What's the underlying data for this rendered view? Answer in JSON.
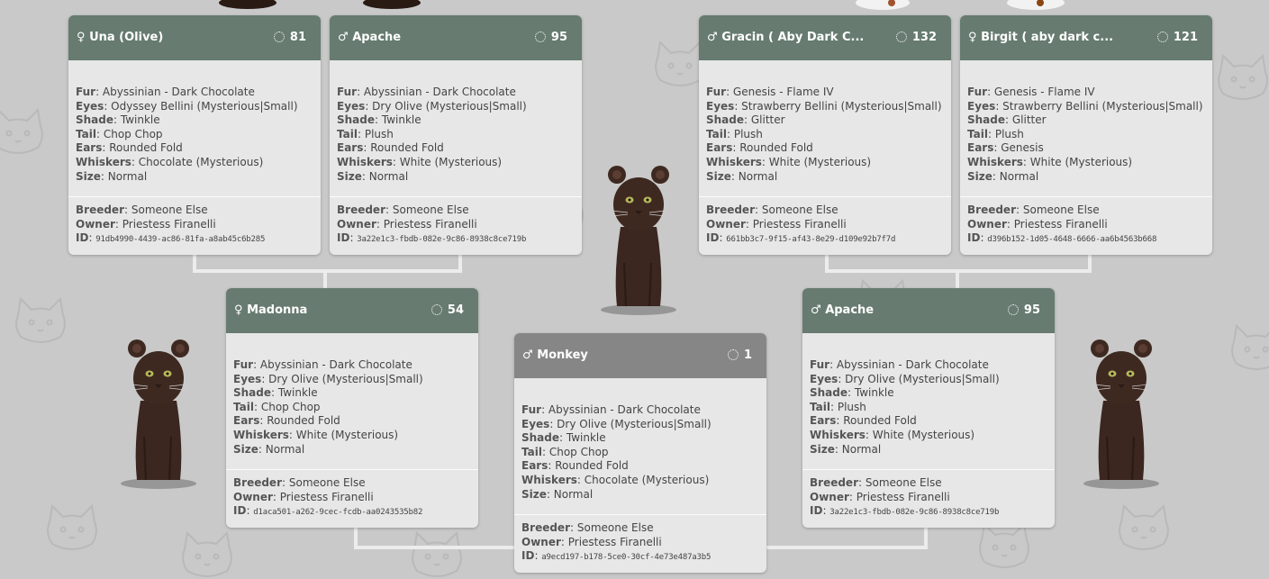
{
  "label_keys": {
    "fur": "Fur",
    "eyes": "Eyes",
    "shade": "Shade",
    "tail": "Tail",
    "ears": "Ears",
    "whiskers": "Whiskers",
    "size": "Size",
    "breeder": "Breeder",
    "owner": "Owner",
    "id": "ID"
  },
  "colors": {
    "header": "#677b70",
    "child_header": "#868686",
    "card_body": "#e7e7e7",
    "background": "#c9c9c9",
    "connector": "#ececec"
  },
  "cats": {
    "una": {
      "sex_symbol": "♀",
      "name": "Una (Olive)",
      "generation": "81",
      "fur": "Abyssinian - Dark Chocolate",
      "eyes": "Odyssey Bellini (Mysterious|Small)",
      "shade": "Twinkle",
      "tail": "Chop Chop",
      "ears": "Rounded Fold",
      "whiskers": "Chocolate (Mysterious)",
      "size": "Normal",
      "breeder": "Someone Else",
      "owner": "Priestess Firanelli",
      "id": "91db4990-4439-ac86-81fa-a8ab45c6b285"
    },
    "apache_top": {
      "sex_symbol": "♂",
      "name": "Apache",
      "generation": "95",
      "fur": "Abyssinian - Dark Chocolate",
      "eyes": "Dry Olive (Mysterious|Small)",
      "shade": "Twinkle",
      "tail": "Plush",
      "ears": "Rounded Fold",
      "whiskers": "White (Mysterious)",
      "size": "Normal",
      "breeder": "Someone Else",
      "owner": "Priestess Firanelli",
      "id": "3a22e1c3-fbdb-082e-9c86-8938c8ce719b"
    },
    "gracin": {
      "sex_symbol": "♂",
      "name": "Gracin ( Aby Dark C...",
      "generation": "132",
      "fur": "Genesis - Flame IV",
      "eyes": "Strawberry Bellini (Mysterious|Small)",
      "shade": "Glitter",
      "tail": "Plush",
      "ears": "Rounded Fold",
      "whiskers": "White (Mysterious)",
      "size": "Normal",
      "breeder": "Someone Else",
      "owner": "Priestess Firanelli",
      "id": "661bb3c7-9f15-af43-8e29-d109e92b7f7d"
    },
    "birgit": {
      "sex_symbol": "♀",
      "name": "Birgit ( aby dark c...",
      "generation": "121",
      "fur": "Genesis - Flame IV",
      "eyes": "Strawberry Bellini (Mysterious|Small)",
      "shade": "Glitter",
      "tail": "Plush",
      "ears": "Genesis",
      "whiskers": "White (Mysterious)",
      "size": "Normal",
      "breeder": "Someone Else",
      "owner": "Priestess Firanelli",
      "id": "d396b152-1d05-4648-6666-aa6b4563b668"
    },
    "madonna": {
      "sex_symbol": "♀",
      "name": "Madonna",
      "generation": "54",
      "fur": "Abyssinian - Dark Chocolate",
      "eyes": "Dry Olive (Mysterious|Small)",
      "shade": "Twinkle",
      "tail": "Chop Chop",
      "ears": "Rounded Fold",
      "whiskers": "White (Mysterious)",
      "size": "Normal",
      "breeder": "Someone Else",
      "owner": "Priestess Firanelli",
      "id": "d1aca501-a262-9cec-fcdb-aa0243535b82"
    },
    "monkey": {
      "sex_symbol": "♂",
      "name": "Monkey",
      "generation": "1",
      "fur": "Abyssinian - Dark Chocolate",
      "eyes": "Dry Olive (Mysterious|Small)",
      "shade": "Twinkle",
      "tail": "Chop Chop",
      "ears": "Rounded Fold",
      "whiskers": "Chocolate (Mysterious)",
      "size": "Normal",
      "breeder": "Someone Else",
      "owner": "Priestess Firanelli",
      "id": "a9ecd197-b178-5ce0-30cf-4e73e487a3b5"
    },
    "apache_mid": {
      "sex_symbol": "♂",
      "name": "Apache",
      "generation": "95",
      "fur": "Abyssinian - Dark Chocolate",
      "eyes": "Dry Olive (Mysterious|Small)",
      "shade": "Twinkle",
      "tail": "Plush",
      "ears": "Rounded Fold",
      "whiskers": "White (Mysterious)",
      "size": "Normal",
      "breeder": "Someone Else",
      "owner": "Priestess Firanelli",
      "id": "3a22e1c3-fbdb-082e-9c86-8938c8ce719b"
    }
  }
}
